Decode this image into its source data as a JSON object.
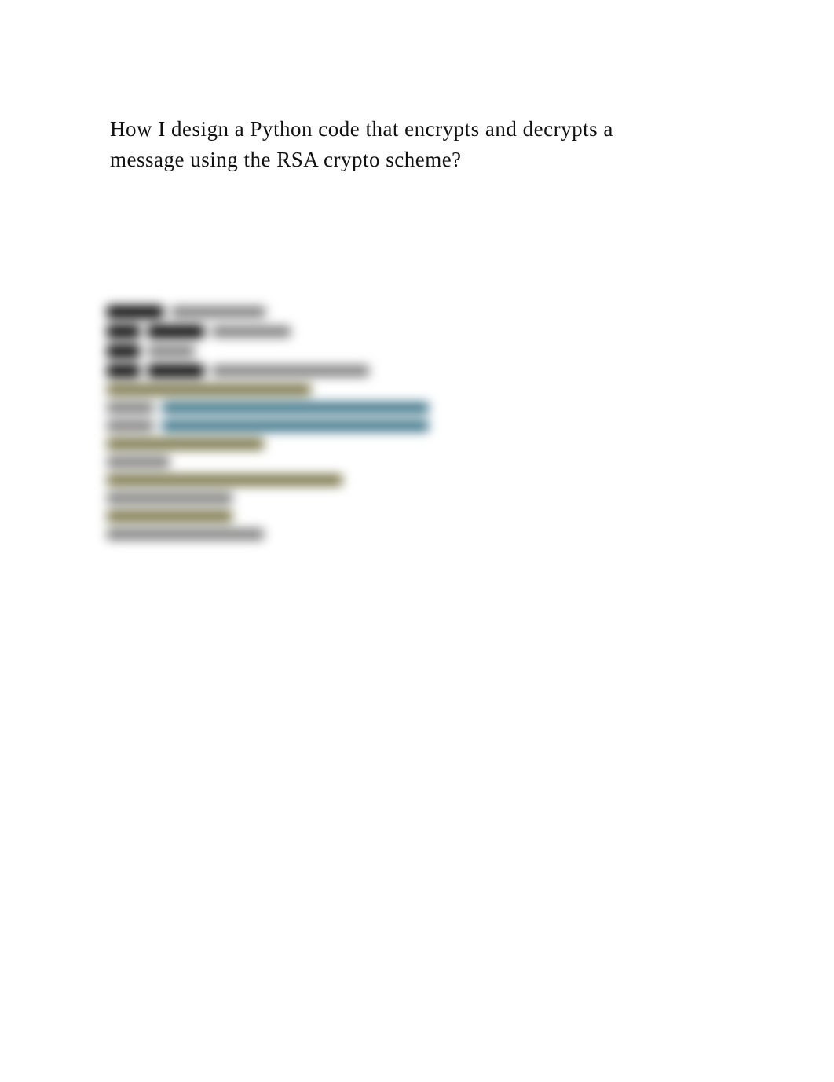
{
  "question": {
    "line1": "How I design a Python code that encrypts and decrypts a",
    "line2": "message using the RSA crypto scheme?"
  },
  "blurred_code": {
    "note": "Content is intentionally blurred / illegible in the source image; only faint shapes are visible.",
    "lines_visible": 13
  }
}
